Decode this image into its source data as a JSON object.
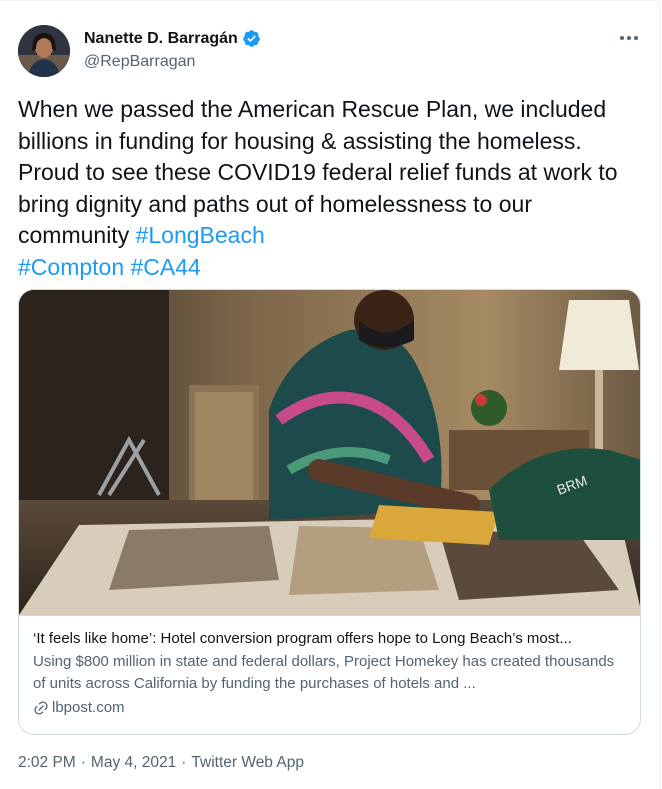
{
  "author": {
    "name": "Nanette D. Barragán",
    "handle": "@RepBarragan",
    "verified_icon": "verified-badge-icon"
  },
  "more_icon": "more-options-icon",
  "tweet": {
    "text_main": "When we passed the American Rescue Plan, we included billions in funding for housing & assisting the homeless. Proud to see these COVID19 federal relief funds at work to bring dignity and paths out of homelessness to our community ",
    "hashtags": [
      "#LongBeach",
      "#Compton",
      "#CA44"
    ]
  },
  "card": {
    "title": "‘It feels like home’: Hotel conversion program offers hope to Long Beach’s most...",
    "description": "Using $800 million in state and federal dollars, Project Homekey has created thousands of units across California by funding the purchases of hotels and ...",
    "domain": "lbpost.com"
  },
  "meta": {
    "time": "2:02 PM",
    "date": "May 4, 2021",
    "separator": "·",
    "app": "Twitter Web App"
  },
  "colors": {
    "link": "#1d9bf0",
    "text": "#0f1419",
    "secondary": "#536471",
    "border": "#cfd9de"
  }
}
